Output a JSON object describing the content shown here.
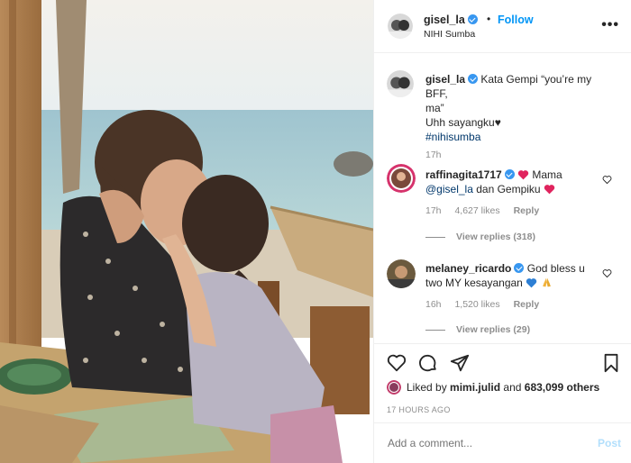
{
  "post": {
    "username": "gisel_la",
    "follow_label": "Follow",
    "separator": "•",
    "location": "NIHI Sumba",
    "more_label": "•••"
  },
  "caption": {
    "username": "gisel_la",
    "text_line1": "Kata Gempi “you’re my BFF,",
    "text_line2": "ma”",
    "text_line3": "Uhh sayangku",
    "text_line3_suffix": "♥",
    "hashtag": "#nihisumba",
    "time": "17h"
  },
  "comments": [
    {
      "username": "raffinagita1717",
      "text_a": "Mama",
      "mention": "@gisel_la",
      "text_b": "dan Gempiku",
      "time": "17h",
      "likes": "4,627 likes",
      "reply_label": "Reply",
      "view_replies": "View replies (318)"
    },
    {
      "username": "melaney_ricardo",
      "text_a": "God bless u",
      "text_b": "two MY kesayangan",
      "time": "16h",
      "likes": "1,520 likes",
      "reply_label": "Reply",
      "view_replies": "View replies (29)"
    }
  ],
  "likes_bar": {
    "prefix": "Liked by",
    "liker": "mimi.julid",
    "joiner": "and",
    "others": "683,099 others"
  },
  "timestamp": "17 HOURS AGO",
  "add_comment": {
    "placeholder": "Add a comment...",
    "post_label": "Post"
  },
  "icons": {
    "like": "heart-icon",
    "comment": "comment-icon",
    "share": "paper-plane-icon",
    "save": "bookmark-icon"
  },
  "colors": {
    "follow": "#0095f6",
    "verified": "#3897f0",
    "hashtag": "#00376b",
    "post_button": "#b2dffc"
  }
}
